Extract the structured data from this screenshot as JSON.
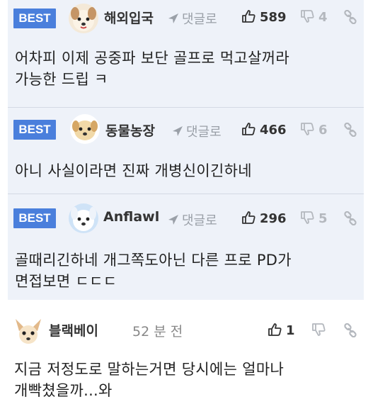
{
  "comments": [
    {
      "best": true,
      "badge": "BEST",
      "nickname": "해외입국",
      "reply_label": "댓글로",
      "upvotes": "589",
      "downvotes": "4",
      "text_lines": [
        "어차피 이제 공중파 보단 골프로 먹고살꺼라",
        "가능한 드립 ㅋ"
      ],
      "avatar_icon": "puppy-face-avatar"
    },
    {
      "best": true,
      "badge": "BEST",
      "nickname": "동물농장",
      "reply_label": "댓글로",
      "upvotes": "466",
      "downvotes": "6",
      "text_lines": [
        "아니 사실이라면 진짜 개병신이긴하네"
      ],
      "avatar_icon": "dog-face-avatar"
    },
    {
      "best": true,
      "badge": "BEST",
      "nickname": "Anflawl",
      "reply_label": "댓글로",
      "upvotes": "296",
      "downvotes": "5",
      "text_lines": [
        "골때리긴하네 개그쪽도아닌 다른 프로 PD가",
        "면접보면 ㄷㄷㄷ"
      ],
      "avatar_icon": "white-dog-avatar"
    },
    {
      "best": false,
      "nickname": "블랙베이",
      "time": "52 분 전",
      "upvotes": "1",
      "downvotes": "",
      "text_lines": [
        "지금 저정도로 말하는거면 당시에는 얼마나",
        "개빡쳤을까...와"
      ],
      "avatar_icon": "chihuahua-avatar"
    }
  ],
  "colors": {
    "badge": "#4a7fdc",
    "best_background": "#eef2f9",
    "muted": "#9aa0a8"
  },
  "icons": [
    "reply-arrow-icon",
    "thumbs-up-icon",
    "thumbs-down-icon",
    "link-icon"
  ]
}
